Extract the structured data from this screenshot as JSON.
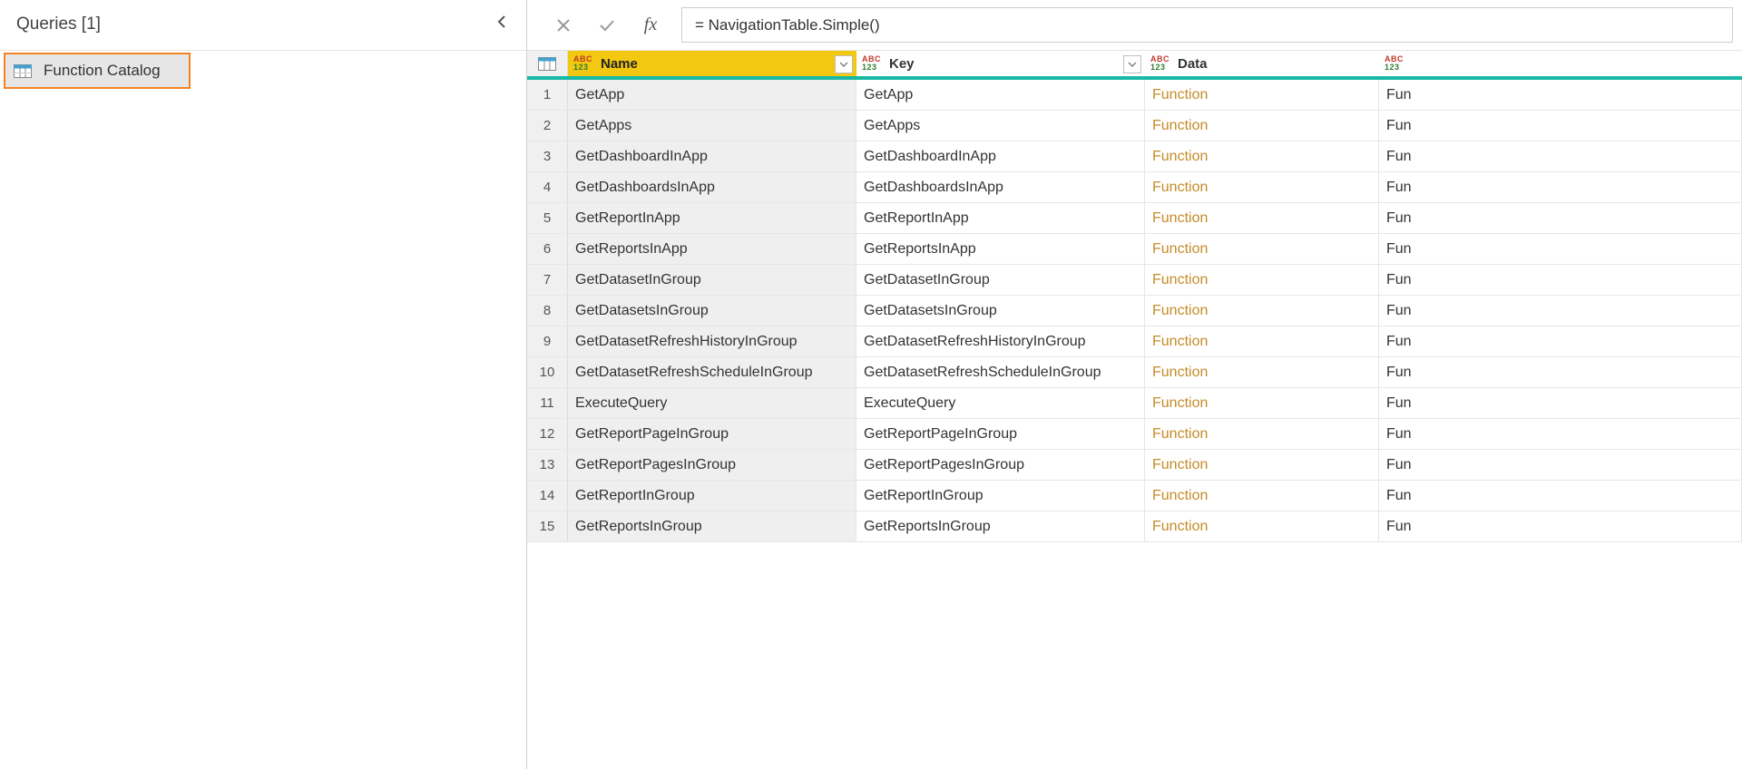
{
  "queries": {
    "title": "Queries [1]",
    "selected": "Function Catalog"
  },
  "formula": {
    "text": "= NavigationTable.Simple()"
  },
  "grid": {
    "columns": {
      "name": "Name",
      "key": "Key",
      "data": "Data"
    },
    "type_abc": "ABC",
    "type_num": "123",
    "rows": [
      {
        "n": "1",
        "name": "GetApp",
        "key": "GetApp",
        "data": "Function",
        "ik": "Fun"
      },
      {
        "n": "2",
        "name": "GetApps",
        "key": "GetApps",
        "data": "Function",
        "ik": "Fun"
      },
      {
        "n": "3",
        "name": "GetDashboardInApp",
        "key": "GetDashboardInApp",
        "data": "Function",
        "ik": "Fun"
      },
      {
        "n": "4",
        "name": "GetDashboardsInApp",
        "key": "GetDashboardsInApp",
        "data": "Function",
        "ik": "Fun"
      },
      {
        "n": "5",
        "name": "GetReportInApp",
        "key": "GetReportInApp",
        "data": "Function",
        "ik": "Fun"
      },
      {
        "n": "6",
        "name": "GetReportsInApp",
        "key": "GetReportsInApp",
        "data": "Function",
        "ik": "Fun"
      },
      {
        "n": "7",
        "name": "GetDatasetInGroup",
        "key": "GetDatasetInGroup",
        "data": "Function",
        "ik": "Fun"
      },
      {
        "n": "8",
        "name": "GetDatasetsInGroup",
        "key": "GetDatasetsInGroup",
        "data": "Function",
        "ik": "Fun"
      },
      {
        "n": "9",
        "name": "GetDatasetRefreshHistoryInGroup",
        "key": "GetDatasetRefreshHistoryInGroup",
        "data": "Function",
        "ik": "Fun"
      },
      {
        "n": "10",
        "name": "GetDatasetRefreshScheduleInGroup",
        "key": "GetDatasetRefreshScheduleInGroup",
        "data": "Function",
        "ik": "Fun"
      },
      {
        "n": "11",
        "name": "ExecuteQuery",
        "key": "ExecuteQuery",
        "data": "Function",
        "ik": "Fun"
      },
      {
        "n": "12",
        "name": "GetReportPageInGroup",
        "key": "GetReportPageInGroup",
        "data": "Function",
        "ik": "Fun"
      },
      {
        "n": "13",
        "name": "GetReportPagesInGroup",
        "key": "GetReportPagesInGroup",
        "data": "Function",
        "ik": "Fun"
      },
      {
        "n": "14",
        "name": "GetReportInGroup",
        "key": "GetReportInGroup",
        "data": "Function",
        "ik": "Fun"
      },
      {
        "n": "15",
        "name": "GetReportsInGroup",
        "key": "GetReportsInGroup",
        "data": "Function",
        "ik": "Fun"
      }
    ]
  }
}
